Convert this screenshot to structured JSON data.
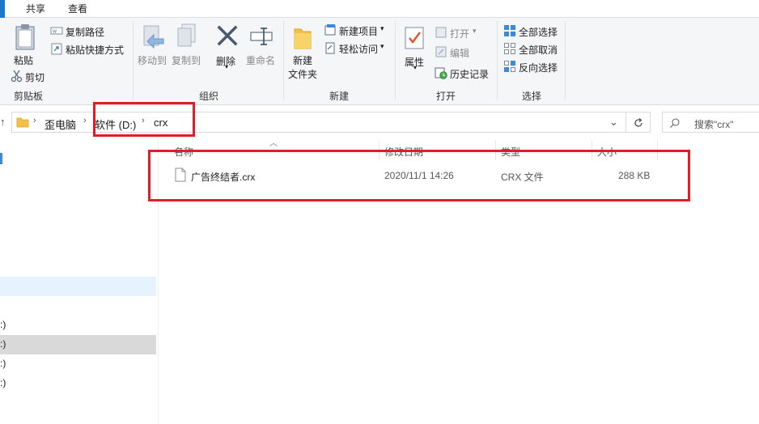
{
  "tabs": [
    {
      "label": "共享"
    },
    {
      "label": "查看"
    }
  ],
  "ribbon": {
    "clipboard": {
      "paste": "粘贴",
      "cut": "剪切",
      "copy_path": "复制路径",
      "paste_shortcut": "粘贴快捷方式",
      "label": "剪贴板"
    },
    "organize": {
      "move_to": "移动到",
      "copy_to": "复制到",
      "delete": "删除",
      "rename": "重命名",
      "label": "组织"
    },
    "new": {
      "new_folder_line1": "新建",
      "new_folder_line2": "文件夹",
      "new_item": "新建项目",
      "easy_access": "轻松访问",
      "label": "新建"
    },
    "open": {
      "properties": "属性",
      "open": "打开",
      "edit": "编辑",
      "history": "历史记录",
      "label": "打开"
    },
    "select": {
      "select_all": "全部选择",
      "select_none": "全部取消",
      "invert": "反向选择",
      "label": "选择"
    }
  },
  "address": {
    "crumbs": [
      "歪电脑",
      "软件 (D:)",
      "crx"
    ],
    "search_placeholder": "搜索\"crx\""
  },
  "nav": {
    "items": [
      ":)",
      ":)",
      ":)",
      ":)"
    ]
  },
  "file_list": {
    "columns": [
      "名称",
      "修改日期",
      "类型",
      "大小"
    ],
    "rows": [
      {
        "name": "广告终结者.crx",
        "modified": "2020/11/1 14:26",
        "type": "CRX 文件",
        "size": "288 KB"
      }
    ]
  },
  "colors": {
    "accent": "#1979ca",
    "annotation_red": "#e41c25",
    "ribbon_bg": "#f5f6f7",
    "selection_bg": "#e5f3ff",
    "nav_selected_gray": "#d9d9d9"
  }
}
